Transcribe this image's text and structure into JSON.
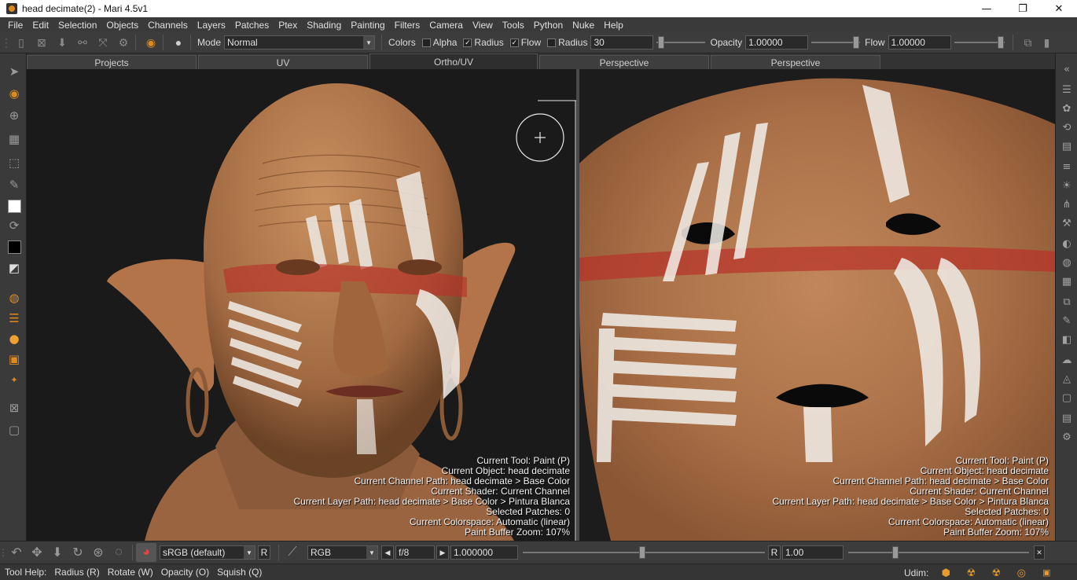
{
  "window": {
    "title": "head decimate(2) - Mari 4.5v1",
    "minimize": "—",
    "maximize": "❐",
    "close": "✕"
  },
  "menu": [
    "File",
    "Edit",
    "Selection",
    "Objects",
    "Channels",
    "Layers",
    "Patches",
    "Ptex",
    "Shading",
    "Painting",
    "Filters",
    "Camera",
    "View",
    "Tools",
    "Python",
    "Nuke",
    "Help"
  ],
  "options": {
    "mode_label": "Mode",
    "mode_value": "Normal",
    "colors_label": "Colors",
    "alpha_label": "Alpha",
    "alpha_checked": false,
    "radius_label": "Radius",
    "radius_checked": true,
    "flow_label": "Flow",
    "flow_checked": true,
    "radius2_label": "Radius",
    "radius2_checked": false,
    "radius_value": "30",
    "opacity_label": "Opacity",
    "opacity_value": "1.00000",
    "flow2_label": "Flow",
    "flow_value": "1.00000"
  },
  "tabs": [
    {
      "label": "Projects",
      "active": false
    },
    {
      "label": "UV",
      "active": false
    },
    {
      "label": "Ortho/UV",
      "active": true
    },
    {
      "label": "Perspective",
      "active": false
    },
    {
      "label": "Perspective",
      "active": false
    }
  ],
  "hud": [
    "Current Tool: Paint (P)",
    "Current Object: head decimate",
    "Current Channel Path: head decimate > Base Color",
    "Current Shader: Current Channel",
    "Current Layer Path: head decimate > Base Color > Pintura Blanca",
    "Selected Patches: 0",
    "Current Colorspace: Automatic (linear)",
    "Paint Buffer Zoom: 107%"
  ],
  "bottom": {
    "colorspace": "sRGB (default)",
    "r_label": "R",
    "channel": "RGB",
    "fstop": "f/8",
    "gain": "1.000000",
    "r2_label": "R",
    "gamma": "1.00"
  },
  "status": {
    "help": "Tool Help:   Radius (R)   Rotate (W)   Opacity (O)   Squish (Q)",
    "udim_label": "Udim:"
  },
  "colors": {
    "accent": "#e08a1e",
    "skin": "#b3764a",
    "paint_white": "#f2efea",
    "paint_red": "#b8312a"
  }
}
